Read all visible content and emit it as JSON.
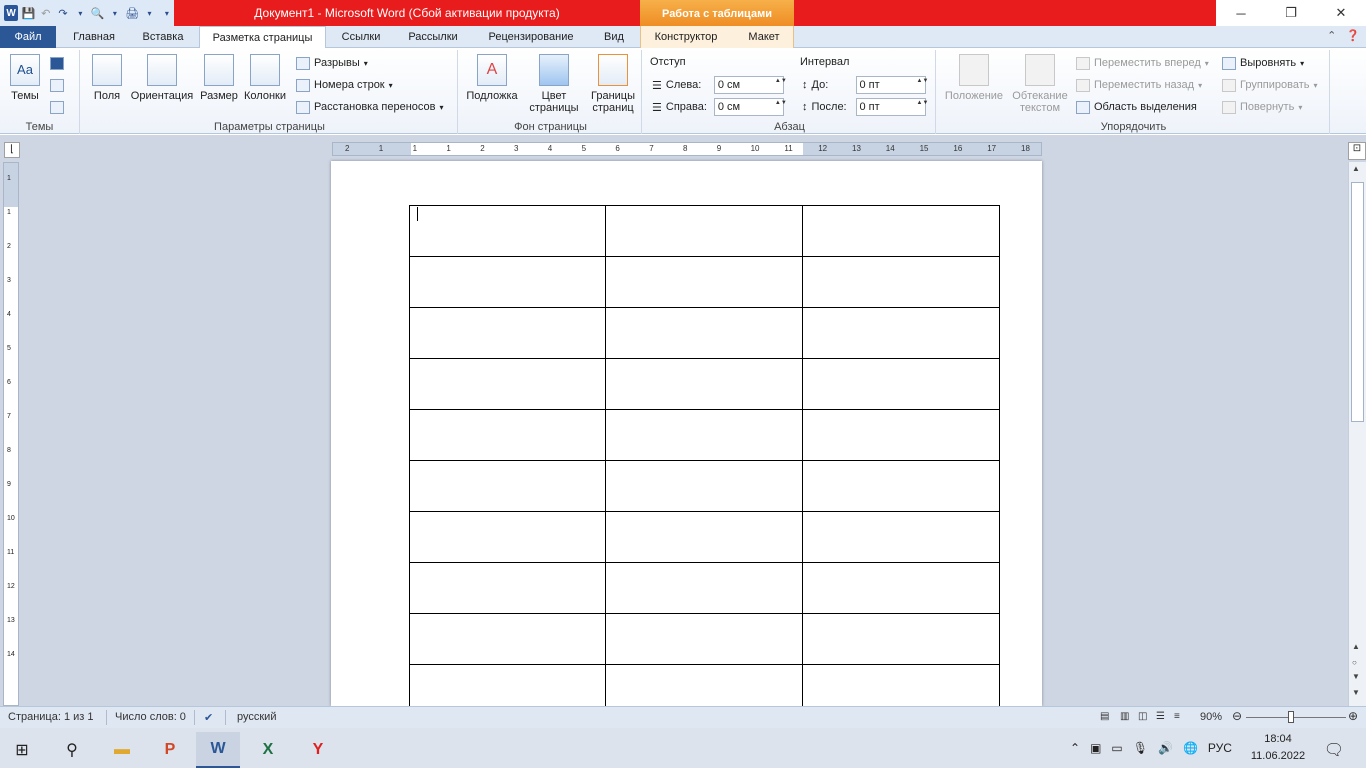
{
  "titlebar": {
    "title": "Документ1 - Microsoft Word (Сбой активации продукта)",
    "context_tab": "Работа с таблицами"
  },
  "tabs": [
    "Файл",
    "Главная",
    "Вставка",
    "Разметка страницы",
    "Ссылки",
    "Рассылки",
    "Рецензирование",
    "Вид",
    "Конструктор",
    "Макет"
  ],
  "ribbon": {
    "themes": {
      "label": "Темы",
      "group": "Темы"
    },
    "page_setup": {
      "fields": "Поля",
      "orientation": "Ориентация",
      "size": "Размер",
      "columns": "Колонки",
      "breaks": "Разрывы",
      "line_numbers": "Номера строк",
      "hyphenation": "Расстановка переносов",
      "group": "Параметры страницы"
    },
    "background": {
      "watermark": "Подложка",
      "page_color_1": "Цвет",
      "page_color_2": "страницы",
      "borders_1": "Границы",
      "borders_2": "страниц",
      "group": "Фон страницы"
    },
    "paragraph": {
      "indent_title": "Отступ",
      "left_label": "Слева:",
      "left_value": "0 см",
      "right_label": "Справа:",
      "right_value": "0 см",
      "spacing_title": "Интервал",
      "before_label": "До:",
      "before_value": "0 пт",
      "after_label": "После:",
      "after_value": "0 пт",
      "group": "Абзац"
    },
    "arrange": {
      "position": "Положение",
      "wrap_1": "Обтекание",
      "wrap_2": "текстом",
      "bring_forward": "Переместить вперед",
      "send_backward": "Переместить назад",
      "selection_pane": "Область выделения",
      "align": "Выровнять",
      "group_btn": "Группировать",
      "rotate": "Повернуть",
      "group": "Упорядочить"
    }
  },
  "ruler": {
    "h_ticks": [
      "2",
      "1",
      "1",
      "1",
      "2",
      "3",
      "4",
      "5",
      "6",
      "7",
      "8",
      "9",
      "10",
      "11",
      "12",
      "13",
      "14",
      "15",
      "16",
      "17",
      "18"
    ],
    "v_ticks": [
      "1",
      "1",
      "2",
      "3",
      "4",
      "5",
      "6",
      "7",
      "8",
      "9",
      "10",
      "11",
      "12",
      "13",
      "14"
    ]
  },
  "document": {
    "table": {
      "rows": 10,
      "cols": 3
    }
  },
  "status": {
    "page": "Страница: 1 из 1",
    "words": "Число слов: 0",
    "language": "русский",
    "zoom": "90%"
  },
  "taskbar": {
    "lang": "РУС",
    "time": "18:04",
    "date": "11.06.2022"
  }
}
